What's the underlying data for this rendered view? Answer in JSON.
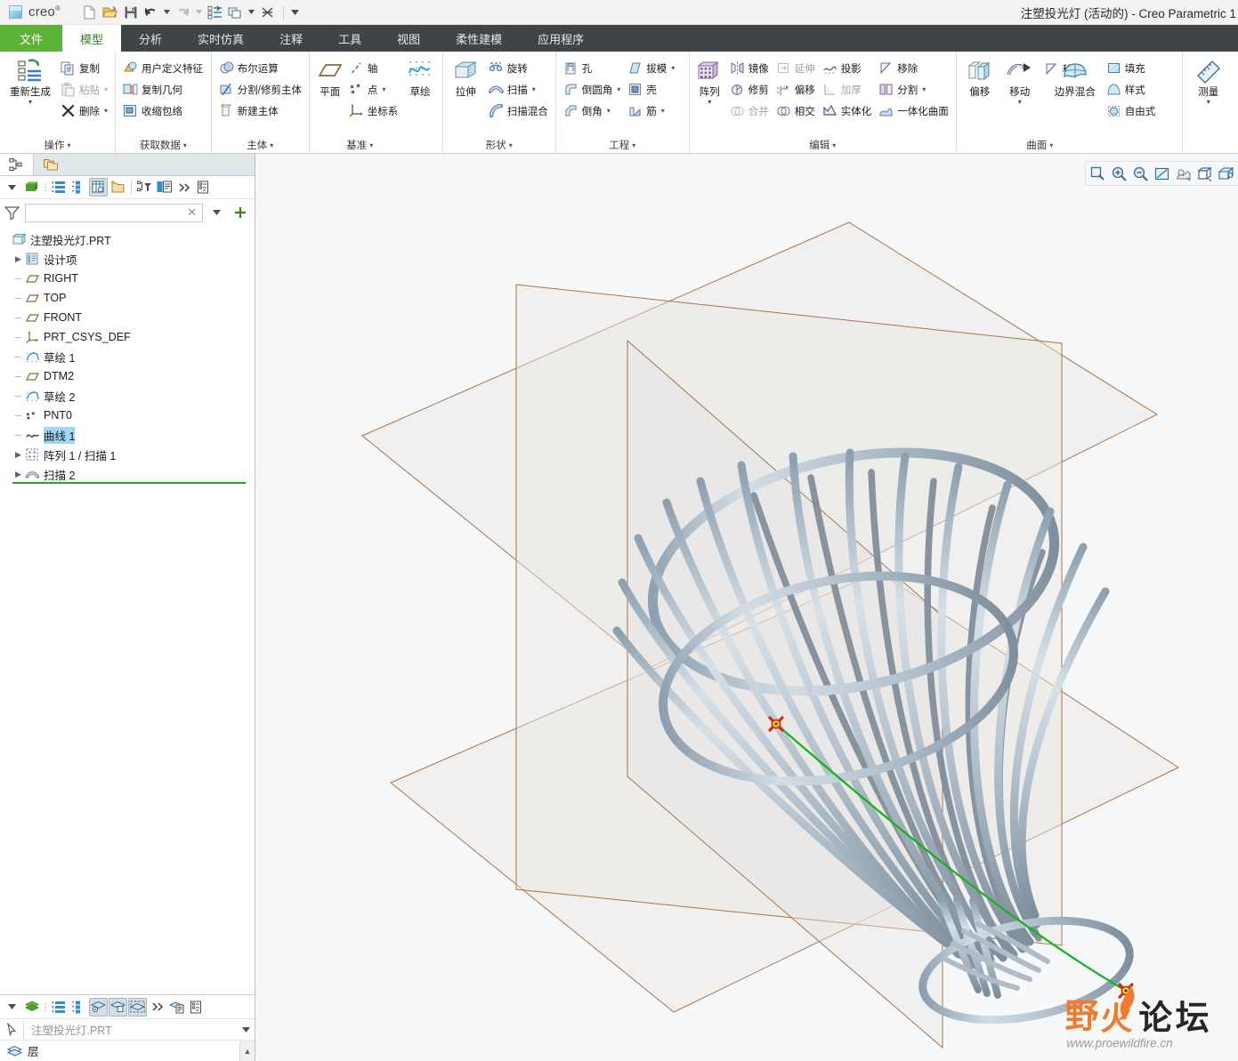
{
  "window": {
    "title": "注塑投光灯 (活动的) - Creo Parametric 1",
    "brand": "creo",
    "brand_sup": "®"
  },
  "quick_access": [
    {
      "name": "new-file-icon",
      "tip": "新建"
    },
    {
      "name": "open-file-icon",
      "tip": "打开"
    },
    {
      "name": "save-icon",
      "tip": "保存"
    },
    {
      "name": "undo-icon",
      "tip": "撤销"
    },
    {
      "name": "redo-icon",
      "tip": "重做"
    },
    {
      "name": "regenerate-icon",
      "tip": "重新生成"
    },
    {
      "name": "window-switch-icon",
      "tip": "窗口"
    },
    {
      "name": "close-window-icon",
      "tip": "关闭"
    }
  ],
  "tabs": [
    {
      "label": "文件",
      "kind": "file"
    },
    {
      "label": "模型",
      "kind": "active"
    },
    {
      "label": "分析",
      "kind": "normal"
    },
    {
      "label": "实时仿真",
      "kind": "normal"
    },
    {
      "label": "注释",
      "kind": "normal"
    },
    {
      "label": "工具",
      "kind": "normal"
    },
    {
      "label": "视图",
      "kind": "normal"
    },
    {
      "label": "柔性建模",
      "kind": "normal"
    },
    {
      "label": "应用程序",
      "kind": "normal"
    }
  ],
  "ribbon": {
    "groups": [
      {
        "title": "操作",
        "big": {
          "label": "重新生成",
          "icon": "regenerate-icon",
          "dropdown": true
        },
        "items": [
          {
            "label": "复制",
            "icon": "copy-icon",
            "disabled": false,
            "dropdown": false
          },
          {
            "label": "粘贴",
            "icon": "paste-icon",
            "disabled": true,
            "dropdown": true
          },
          {
            "label": "删除",
            "icon": "delete-icon",
            "disabled": false,
            "dropdown": true
          }
        ]
      },
      {
        "title": "获取数据",
        "items": [
          {
            "label": "用户定义特征",
            "icon": "udf-icon",
            "disabled": false,
            "dropdown": false
          },
          {
            "label": "复制几何",
            "icon": "copy-geometry-icon",
            "disabled": false,
            "dropdown": false
          },
          {
            "label": "收缩包络",
            "icon": "shrinkwrap-icon",
            "disabled": false,
            "dropdown": false
          }
        ]
      },
      {
        "title": "主体",
        "items": [
          {
            "label": "布尔运算",
            "icon": "boolean-icon",
            "disabled": false,
            "dropdown": false
          },
          {
            "label": "分割/修剪主体",
            "icon": "split-body-icon",
            "disabled": false,
            "dropdown": false
          },
          {
            "label": "新建主体",
            "icon": "new-body-icon",
            "disabled": false,
            "dropdown": false
          }
        ]
      },
      {
        "title": "基准",
        "big": {
          "label": "平面",
          "icon": "datum-plane-icon",
          "dropdown": false
        },
        "items": [
          {
            "label": "轴",
            "icon": "datum-axis-icon",
            "disabled": false,
            "dropdown": false
          },
          {
            "label": "点",
            "icon": "datum-point-icon",
            "disabled": false,
            "dropdown": true
          },
          {
            "label": "坐标系",
            "icon": "datum-csys-icon",
            "disabled": false,
            "dropdown": false
          }
        ],
        "big2": {
          "label": "草绘",
          "icon": "sketch-icon",
          "dropdown": false
        }
      },
      {
        "title": "形状",
        "big": {
          "label": "拉伸",
          "icon": "extrude-icon",
          "dropdown": false
        },
        "items": [
          {
            "label": "旋转",
            "icon": "revolve-icon",
            "disabled": false,
            "dropdown": false
          },
          {
            "label": "扫描",
            "icon": "sweep-icon",
            "disabled": false,
            "dropdown": true
          },
          {
            "label": "扫描混合",
            "icon": "swept-blend-icon",
            "disabled": false,
            "dropdown": false
          }
        ]
      },
      {
        "title": "工程",
        "col1": [
          {
            "label": "孔",
            "icon": "hole-icon",
            "disabled": false,
            "dropdown": false
          },
          {
            "label": "倒圆角",
            "icon": "round-icon",
            "disabled": false,
            "dropdown": true
          },
          {
            "label": "倒角",
            "icon": "chamfer-icon",
            "disabled": false,
            "dropdown": true
          }
        ],
        "col2": [
          {
            "label": "拔模",
            "icon": "draft-icon",
            "disabled": false,
            "dropdown": true
          },
          {
            "label": "壳",
            "icon": "shell-icon",
            "disabled": false,
            "dropdown": false
          },
          {
            "label": "筋",
            "icon": "rib-icon",
            "disabled": false,
            "dropdown": true
          }
        ]
      },
      {
        "title": "编辑",
        "big": {
          "label": "阵列",
          "icon": "pattern-icon",
          "dropdown": true
        },
        "col1": [
          {
            "label": "镜像",
            "icon": "mirror-icon",
            "disabled": false,
            "dropdown": false
          },
          {
            "label": "修剪",
            "icon": "trim-icon",
            "disabled": false,
            "dropdown": false
          },
          {
            "label": "合并",
            "icon": "merge-icon",
            "disabled": true,
            "dropdown": false
          }
        ],
        "col2": [
          {
            "label": "延伸",
            "icon": "extend-icon",
            "disabled": true,
            "dropdown": false
          },
          {
            "label": "偏移",
            "icon": "offset-edit-icon",
            "disabled": false,
            "dropdown": false
          },
          {
            "label": "相交",
            "icon": "intersect-icon",
            "disabled": false,
            "dropdown": false
          }
        ],
        "col3": [
          {
            "label": "投影",
            "icon": "project-icon",
            "disabled": false,
            "dropdown": false
          },
          {
            "label": "加厚",
            "icon": "thicken-icon",
            "disabled": true,
            "dropdown": false
          },
          {
            "label": "实体化",
            "icon": "solidify-icon",
            "disabled": false,
            "dropdown": false
          }
        ],
        "col4": [
          {
            "label": "移除",
            "icon": "remove-icon",
            "disabled": false,
            "dropdown": false
          },
          {
            "label": "分割",
            "icon": "split-surf-icon",
            "disabled": false,
            "dropdown": true
          },
          {
            "label": "一体化曲面",
            "icon": "unified-surface-icon",
            "disabled": false,
            "dropdown": false
          }
        ]
      },
      {
        "title": "曲面",
        "big": {
          "label": "偏移",
          "icon": "surf-offset-icon",
          "dropdown": false
        },
        "big2": {
          "label": "移动",
          "icon": "surf-move-icon",
          "dropdown": true
        },
        "remove": {
          "label": "移除",
          "icon": "surf-remove-icon"
        },
        "big3": {
          "label": "边界混合",
          "icon": "boundary-blend-icon",
          "dropdown": false
        },
        "items": [
          {
            "label": "填充",
            "icon": "fill-icon",
            "disabled": false,
            "dropdown": false
          },
          {
            "label": "样式",
            "icon": "style-icon",
            "disabled": false,
            "dropdown": false
          },
          {
            "label": "自由式",
            "icon": "freestyle-icon",
            "disabled": false,
            "dropdown": false
          }
        ]
      },
      {
        "title": "",
        "big": {
          "label": "测量",
          "icon": "measure-icon",
          "dropdown": true
        }
      }
    ]
  },
  "navigator": {
    "tabs": [
      {
        "name": "model-tree-tab",
        "icon": "model-tree-icon",
        "active": true
      },
      {
        "name": "folder-browser-tab",
        "icon": "folder-browser-icon",
        "active": false
      }
    ],
    "toolbar": [
      {
        "name": "tree-settings-caret",
        "icon": "caret-down-icon",
        "pressed": false
      },
      {
        "name": "show-cube-icon",
        "icon": "green-cube-icon",
        "pressed": false
      },
      {
        "name": "tree-more-dots",
        "icon": "vertical-dots-icon",
        "pressed": false
      },
      {
        "name": "tree-list-view",
        "icon": "list-view-icon",
        "pressed": false
      },
      {
        "name": "tree-detail-view",
        "icon": "detail-view-icon",
        "pressed": false
      },
      {
        "name": "tree-columns-view",
        "icon": "columns-view-icon",
        "pressed": true
      },
      {
        "name": "tree-new-folder",
        "icon": "new-folder-icon",
        "pressed": false
      },
      {
        "name": "tree-filter",
        "icon": "tree-filter-icon",
        "pressed": false
      },
      {
        "name": "tree-layout",
        "icon": "tree-layout-icon",
        "pressed": false
      },
      {
        "name": "tree-overflow",
        "icon": "chevrons-right-icon",
        "pressed": false
      },
      {
        "name": "tree-properties",
        "icon": "properties-icon",
        "pressed": false
      }
    ],
    "filter": {
      "value": "",
      "placeholder": ""
    },
    "tree": [
      {
        "label": "注塑投光灯.PRT",
        "icon": "part-icon",
        "indent": 0,
        "expander": "none",
        "selected": false
      },
      {
        "label": "设计项",
        "icon": "design-items-icon",
        "indent": 1,
        "expander": "collapsed",
        "selected": false
      },
      {
        "label": "RIGHT",
        "icon": "datum-plane-small-icon",
        "indent": 1,
        "expander": "leaf",
        "selected": false
      },
      {
        "label": "TOP",
        "icon": "datum-plane-small-icon",
        "indent": 1,
        "expander": "leaf",
        "selected": false
      },
      {
        "label": "FRONT",
        "icon": "datum-plane-small-icon",
        "indent": 1,
        "expander": "leaf",
        "selected": false
      },
      {
        "label": "PRT_CSYS_DEF",
        "icon": "csys-small-icon",
        "indent": 1,
        "expander": "leaf",
        "selected": false
      },
      {
        "label": "草绘 1",
        "icon": "sketch-small-icon",
        "indent": 1,
        "expander": "leaf",
        "selected": false
      },
      {
        "label": "DTM2",
        "icon": "datum-plane-small-icon",
        "indent": 1,
        "expander": "leaf",
        "selected": false
      },
      {
        "label": "草绘 2",
        "icon": "sketch-small-icon",
        "indent": 1,
        "expander": "leaf",
        "selected": false
      },
      {
        "label": "PNT0",
        "icon": "point-small-icon",
        "indent": 1,
        "expander": "leaf",
        "selected": false
      },
      {
        "label": "曲线 1",
        "icon": "curve-small-icon",
        "indent": 1,
        "expander": "leaf",
        "selected": true
      },
      {
        "label": "阵列 1 / 扫描 1",
        "icon": "pattern-small-icon",
        "indent": 1,
        "expander": "collapsed",
        "selected": false
      },
      {
        "label": "扫描 2",
        "icon": "sweep-small-icon",
        "indent": 1,
        "expander": "collapsed",
        "selected": false
      }
    ],
    "bottom_toolbar": [
      {
        "name": "layer-settings-caret",
        "icon": "caret-down-icon",
        "pressed": false
      },
      {
        "name": "layers-icon",
        "icon": "green-layers-icon",
        "pressed": false
      },
      {
        "name": "layer-more-dots",
        "icon": "vertical-dots-icon",
        "pressed": false
      },
      {
        "name": "layer-list-view",
        "icon": "list-view-icon",
        "pressed": false
      },
      {
        "name": "layer-detail-view",
        "icon": "detail-view-icon",
        "pressed": false
      },
      {
        "name": "layer-show-hide",
        "icon": "layer-eye-icon",
        "pressed": true
      },
      {
        "name": "layer-isolate",
        "icon": "layer-cube-icon",
        "pressed": true
      },
      {
        "name": "layer-select",
        "icon": "layer-dashed-icon",
        "pressed": true
      },
      {
        "name": "layer-overflow",
        "icon": "chevrons-right-icon",
        "pressed": false
      },
      {
        "name": "layer-new",
        "icon": "layer-new-icon",
        "pressed": false
      },
      {
        "name": "layer-properties",
        "icon": "properties-icon",
        "pressed": false
      }
    ],
    "layer_model": "注塑投光灯.PRT",
    "layer_root": "层"
  },
  "viewport": {
    "toolbar": [
      {
        "name": "zoom-box-button",
        "icon": "zoom-box-icon"
      },
      {
        "name": "zoom-in-button",
        "icon": "zoom-in-icon"
      },
      {
        "name": "zoom-out-button",
        "icon": "zoom-out-icon"
      },
      {
        "name": "refit-button",
        "icon": "refit-icon"
      },
      {
        "name": "repaint-button",
        "icon": "repaint-icon"
      },
      {
        "name": "display-style-button",
        "icon": "display-style-icon"
      },
      {
        "name": "saved-views-button",
        "icon": "saved-views-icon"
      }
    ],
    "colors": {
      "background": "#f7f8fa",
      "model": "#aebdc9",
      "datum_plane_outline": "#a8764a",
      "datum_plane_fill": "#e8e8e4",
      "selected_curve": "#12b41b",
      "point_marker_outer": "#d42a12",
      "point_marker_inner": "#f5dd1e"
    },
    "model_name": "注塑投光灯",
    "watermark": {
      "text": "野火论坛",
      "url": "www.proewildfire.cn"
    }
  }
}
